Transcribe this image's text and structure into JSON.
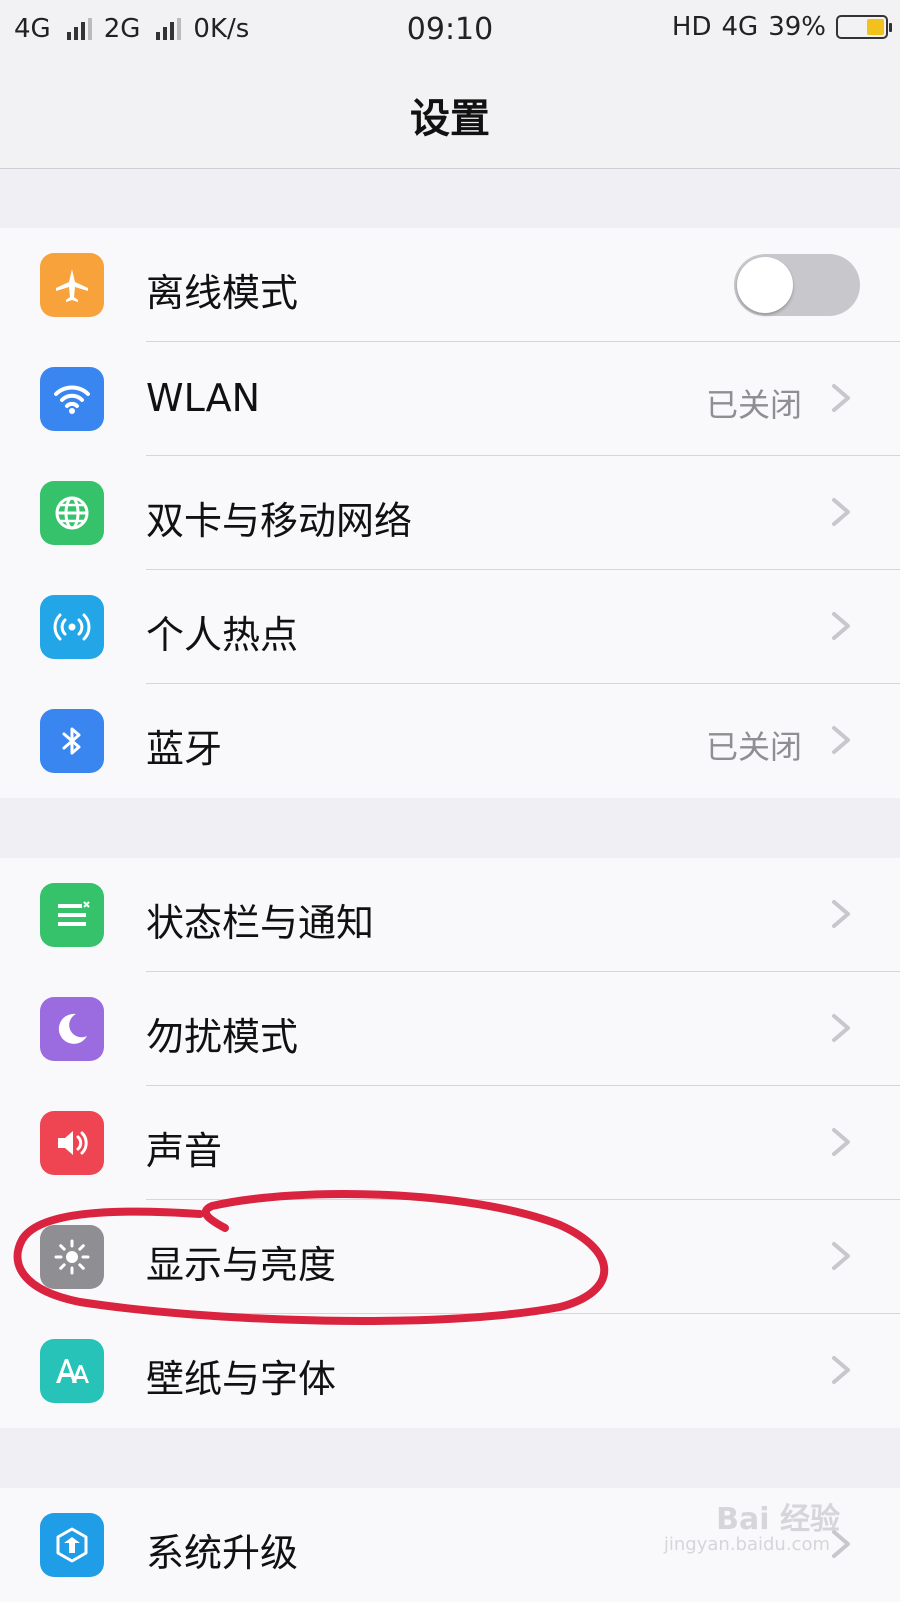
{
  "status_bar": {
    "network1": "4G",
    "network2": "2G",
    "speed": "0K/s",
    "time": "09:10",
    "hd": "HD",
    "lte": "4G",
    "battery_percent": "39%",
    "battery_level": 0.39,
    "battery_color": "#f3c11b"
  },
  "navbar": {
    "title": "设置"
  },
  "groups": [
    {
      "items": [
        {
          "label": "离线模式",
          "icon": "airplane-icon",
          "color": "#f7a23a",
          "toggle": false
        },
        {
          "label": "WLAN",
          "icon": "wifi-icon",
          "color": "#3a86f0",
          "value": "已关闭"
        },
        {
          "label": "双卡与移动网络",
          "icon": "globe-icon",
          "color": "#36c26a"
        },
        {
          "label": "个人热点",
          "icon": "hotspot-icon",
          "color": "#23a6e8"
        },
        {
          "label": "蓝牙",
          "icon": "bluetooth-icon",
          "color": "#3a86f0",
          "value": "已关闭"
        }
      ]
    },
    {
      "items": [
        {
          "label": "状态栏与通知",
          "icon": "notification-list-icon",
          "color": "#36c26a"
        },
        {
          "label": "勿扰模式",
          "icon": "moon-icon",
          "color": "#9b6be0"
        },
        {
          "label": "声音",
          "icon": "speaker-icon",
          "color": "#ef4553"
        },
        {
          "label": "显示与亮度",
          "icon": "sun-icon",
          "color": "#8e8e93"
        },
        {
          "label": "壁纸与字体",
          "icon": "font-icon",
          "color": "#28c3b8"
        }
      ]
    },
    {
      "items": [
        {
          "label": "系统升级",
          "icon": "upgrade-icon",
          "color": "#1f9de6"
        }
      ]
    }
  ],
  "annotation": {
    "circle_color": "#d9233f"
  },
  "watermark": {
    "brand": "Bai 经验",
    "url": "jingyan.baidu.com"
  }
}
